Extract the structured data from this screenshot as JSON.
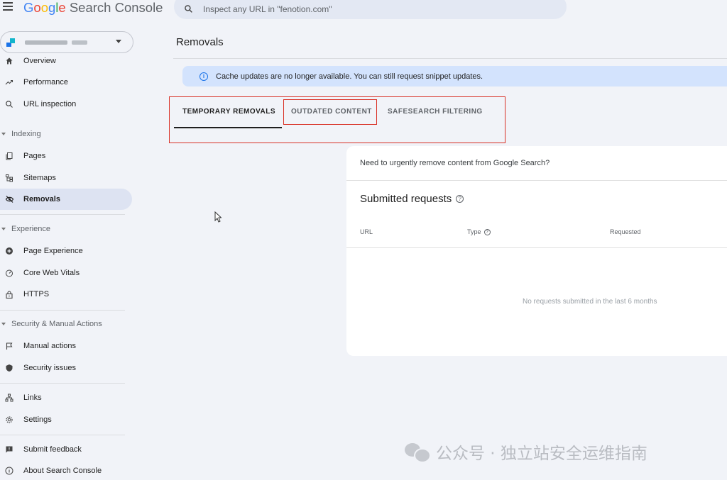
{
  "header": {
    "app_title": "Search Console",
    "logo_letters": [
      "G",
      "o",
      "o",
      "g",
      "l",
      "e"
    ],
    "search_placeholder": "Inspect any URL in \"fenotion.com\""
  },
  "sidebar": {
    "items": [
      {
        "label": "Overview",
        "icon": "home-icon"
      },
      {
        "label": "Performance",
        "icon": "trending-up-icon"
      },
      {
        "label": "URL inspection",
        "icon": "search-icon"
      },
      {
        "label": "Pages",
        "icon": "pages-icon"
      },
      {
        "label": "Sitemaps",
        "icon": "sitemap-icon"
      },
      {
        "label": "Removals",
        "icon": "eye-off-icon",
        "active": true
      },
      {
        "label": "Page Experience",
        "icon": "plus-circle-icon"
      },
      {
        "label": "Core Web Vitals",
        "icon": "gauge-icon"
      },
      {
        "label": "HTTPS",
        "icon": "lock-icon"
      },
      {
        "label": "Manual actions",
        "icon": "flag-icon"
      },
      {
        "label": "Security issues",
        "icon": "shield-icon"
      },
      {
        "label": "Links",
        "icon": "links-icon"
      },
      {
        "label": "Settings",
        "icon": "gear-icon"
      },
      {
        "label": "Submit feedback",
        "icon": "feedback-icon"
      },
      {
        "label": "About Search Console",
        "icon": "info-icon"
      }
    ],
    "sections": {
      "indexing": "Indexing",
      "experience": "Experience",
      "security": "Security & Manual Actions"
    }
  },
  "main": {
    "page_title": "Removals",
    "banner_text": "Cache updates are no longer available. You can still request snippet updates.",
    "tabs": [
      {
        "label": "TEMPORARY REMOVALS",
        "selected": true
      },
      {
        "label": "OUTDATED CONTENT"
      },
      {
        "label": "SAFESEARCH FILTERING"
      }
    ],
    "card": {
      "prompt": "Need to urgently remove content from Google Search?",
      "heading": "Submitted requests",
      "columns": [
        "URL",
        "Type",
        "Requested"
      ],
      "empty_text": "No requests submitted in the last 6 months"
    }
  },
  "watermark": "公众号 · 独立站安全运维指南",
  "colors": {
    "accent": "#1a73e8",
    "highlight_red": "#d93025",
    "active_bg": "#dde3f2",
    "banner_bg": "#d3e3fd",
    "page_bg": "#f1f3f8"
  }
}
